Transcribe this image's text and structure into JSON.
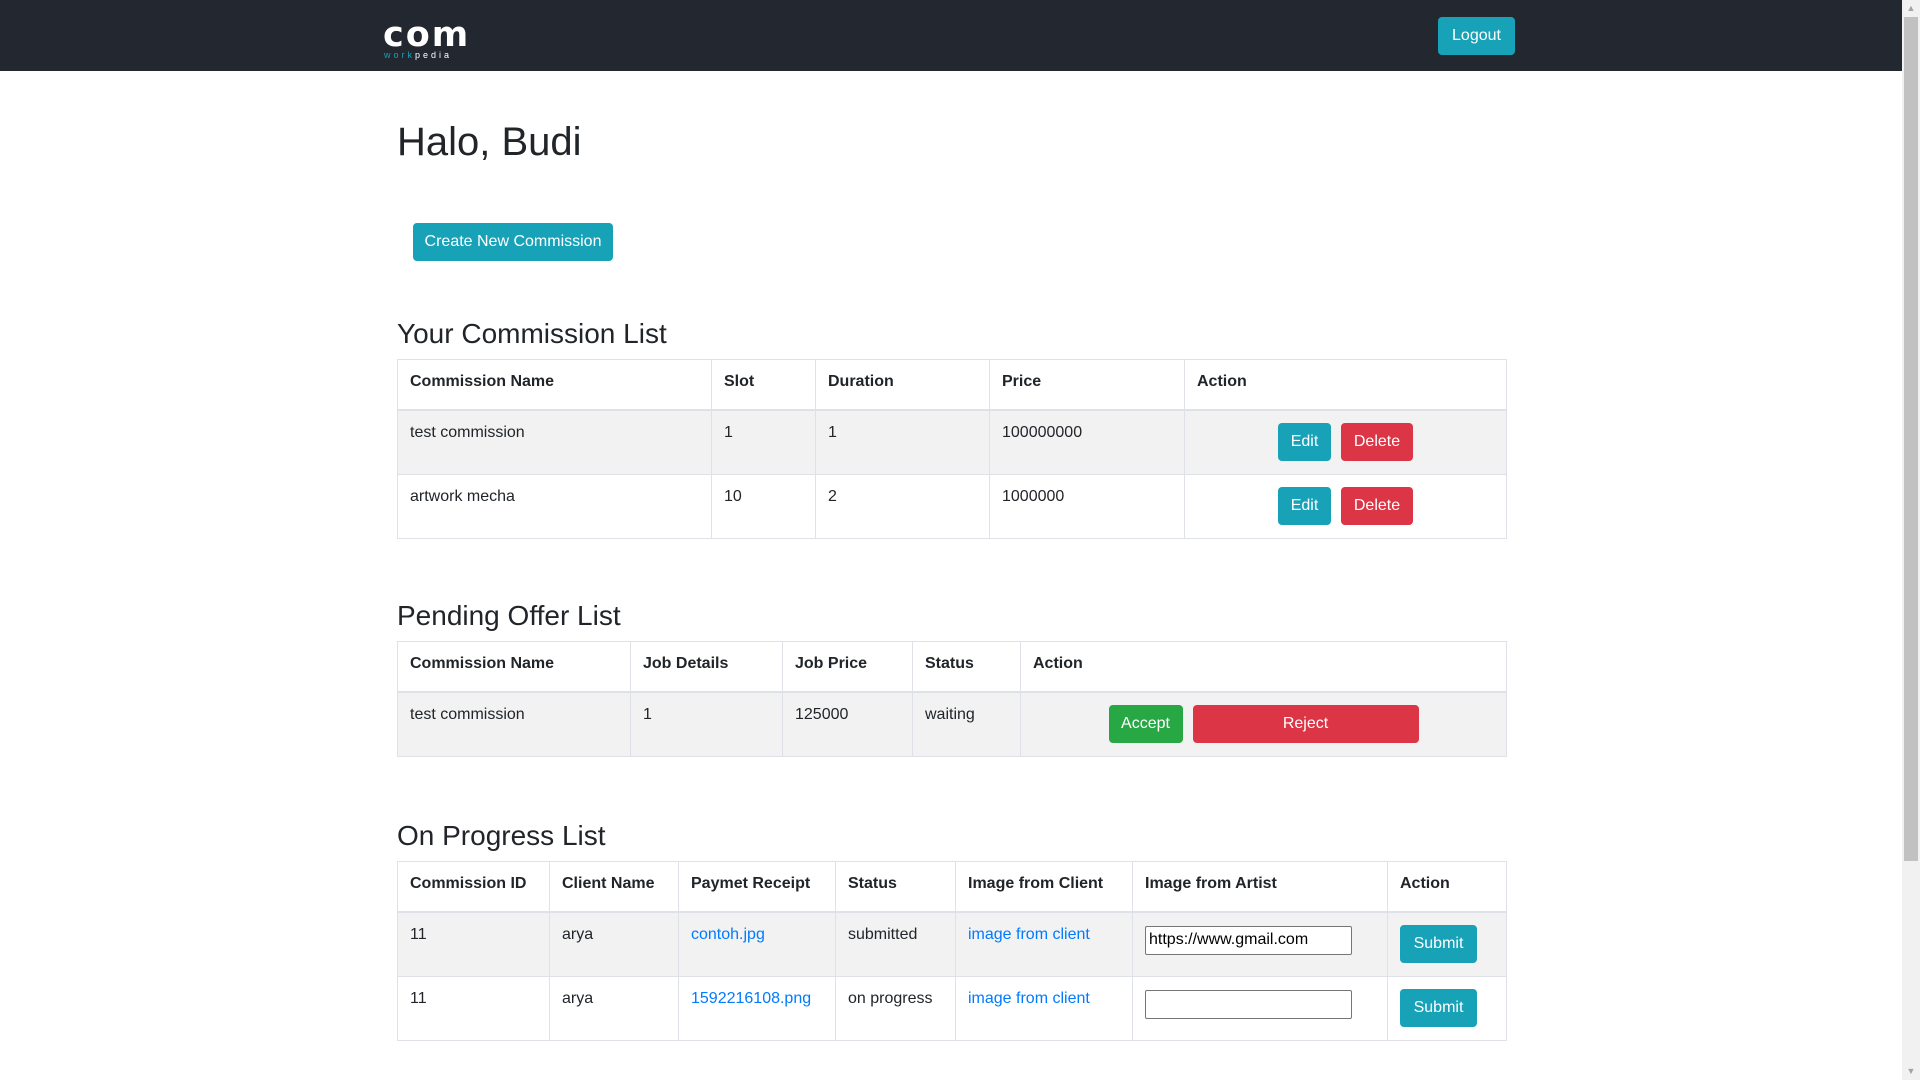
{
  "navbar": {
    "logo_main": "com",
    "logo_sub_part1": "work",
    "logo_sub_part2": "pedia",
    "logout_label": "Logout"
  },
  "greeting": "Halo, Budi",
  "create_button_label": "Create New Commission",
  "commission_list": {
    "title": "Your Commission List",
    "headers": [
      "Commission Name",
      "Slot",
      "Duration",
      "Price",
      "Action"
    ],
    "rows": [
      {
        "name": "test commission",
        "slot": "1",
        "duration": "1",
        "price": "100000000"
      },
      {
        "name": "artwork mecha",
        "slot": "10",
        "duration": "2",
        "price": "1000000"
      }
    ],
    "edit_label": "Edit",
    "delete_label": "Delete"
  },
  "pending_list": {
    "title": "Pending Offer List",
    "headers": [
      "Commission Name",
      "Job Details",
      "Job Price",
      "Status",
      "Action"
    ],
    "rows": [
      {
        "name": "test commission",
        "details": "1",
        "price": "125000",
        "status": "waiting"
      }
    ],
    "accept_label": "Accept",
    "reject_label": "Reject"
  },
  "progress_list": {
    "title": "On Progress List",
    "headers": [
      "Commission ID",
      "Client Name",
      "Paymet Receipt",
      "Status",
      "Image from Client",
      "Image from Artist",
      "Action"
    ],
    "rows": [
      {
        "id": "11",
        "client": "arya",
        "receipt": "contoh.jpg",
        "status": "submitted",
        "client_image": "image from client",
        "artist_image": "https://www.gmail.com"
      },
      {
        "id": "11",
        "client": "arya",
        "receipt": "1592216108.png",
        "status": "on progress",
        "client_image": "image from client",
        "artist_image": ""
      }
    ],
    "submit_label": "Submit"
  },
  "colors": {
    "navbar_bg": "#222730",
    "info": "#17a2b8",
    "danger": "#dc3545",
    "success": "#28a745",
    "link": "#007bff"
  }
}
